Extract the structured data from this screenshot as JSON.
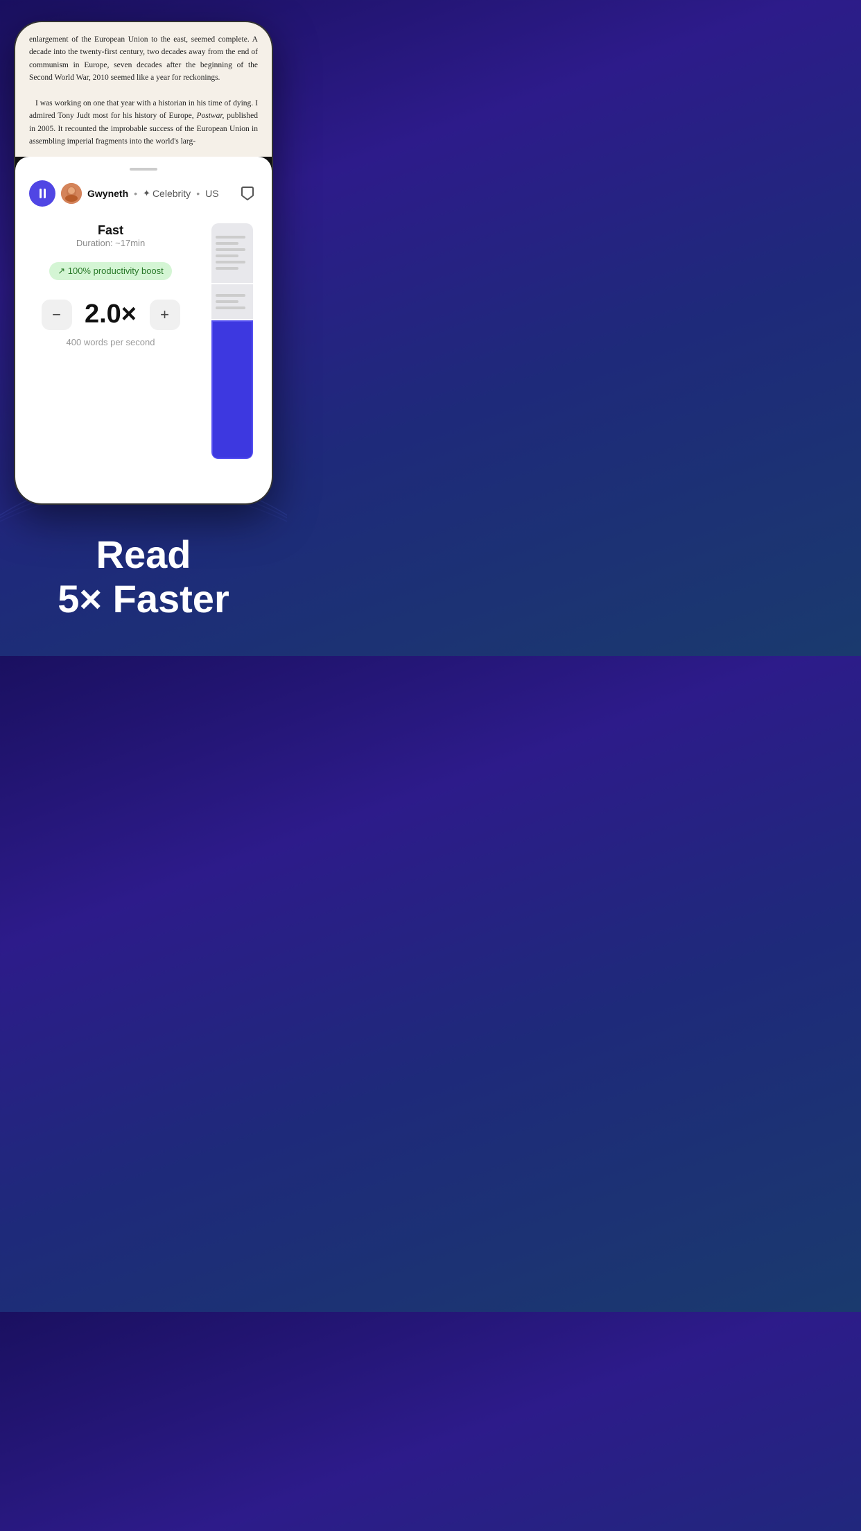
{
  "background": {
    "colors": [
      "#1a1060",
      "#2d1b8a",
      "#1e2a7a",
      "#1a3a6e"
    ]
  },
  "book_text": {
    "paragraph1": "enlargement of the European Union to the east, seemed complete. A decade into the twenty-first century, two decades away from the end of communism in Europe, seven decades after the beginning of the Second World War, 2010 seemed like a year for reckonings.",
    "paragraph2": "I was working on one that year with a historian in his time of dying. I admired Tony Judt most for his history of Europe, Postwar, published in 2005. It recounted the improbable success of the European Union in assembling imperial fragments into the world's larg-"
  },
  "voice_bar": {
    "pause_label": "pause",
    "voice_name": "Gwyneth",
    "separator1": "•",
    "sparkle": "✦",
    "voice_category": "Celebrity",
    "separator2": "•",
    "voice_region": "US"
  },
  "speed": {
    "label": "Fast",
    "duration": "Duration: ~17min",
    "productivity_badge": "↗ 100% productivity boost",
    "value": "2.0×",
    "words": "400 words per second",
    "minus": "−",
    "plus": "+"
  },
  "tagline": {
    "line1": "Read",
    "line2": "5× Faster"
  }
}
